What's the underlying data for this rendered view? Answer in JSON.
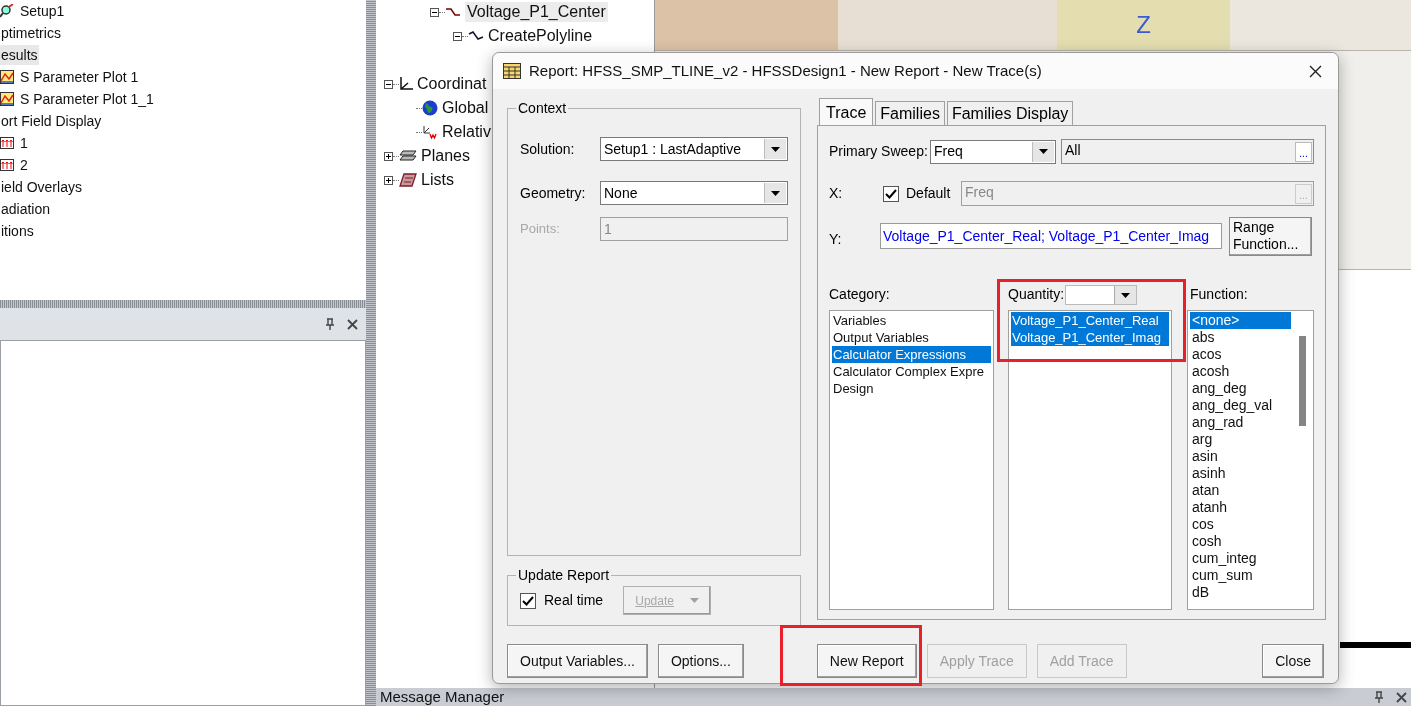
{
  "left_tree": {
    "items": [
      {
        "kind": "setup",
        "label": "Setup1",
        "selected": false
      },
      {
        "kind": "folder",
        "label": "ptimetrics",
        "selected": false
      },
      {
        "kind": "folder",
        "label": "esults",
        "selected": true,
        "children": [
          {
            "kind": "plot",
            "label": "S Parameter Plot 1",
            "selected": false
          },
          {
            "kind": "plot",
            "label": "S Parameter Plot 1_1",
            "selected": false
          }
        ]
      },
      {
        "kind": "folder",
        "label": "ort Field Display",
        "selected": false,
        "children": [
          {
            "kind": "port",
            "label": "1",
            "selected": false
          },
          {
            "kind": "port",
            "label": "2",
            "selected": false
          }
        ]
      },
      {
        "kind": "folder",
        "label": "ield Overlays",
        "selected": false
      },
      {
        "kind": "folder",
        "label": "adiation",
        "selected": false
      },
      {
        "kind": "folder",
        "label": "itions",
        "selected": false
      }
    ]
  },
  "middle_tree": {
    "top": [
      {
        "kind": "line",
        "label": "Voltage_P1_Center",
        "expanded": true,
        "selected": true,
        "children": [
          {
            "kind": "polyline",
            "label": "CreatePolyline",
            "expanded": true,
            "selected": false
          }
        ]
      }
    ],
    "items": [
      {
        "kind": "axes",
        "label": "Coordinat",
        "expanded": true,
        "selected": false,
        "children": [
          {
            "kind": "globe",
            "label": "Global",
            "selected": false
          },
          {
            "kind": "relative",
            "label": "Relativ",
            "selected": false
          }
        ]
      },
      {
        "kind": "planes",
        "label": "Planes",
        "expanded": false,
        "selected": false
      },
      {
        "kind": "lists",
        "label": "Lists",
        "expanded": false,
        "selected": false
      }
    ]
  },
  "viewport": {
    "axis_label": "Z"
  },
  "message_manager": {
    "title": "Message Manager"
  },
  "dialog": {
    "title": "Report: HFSS_SMP_TLINE_v2 - HFSSDesign1 - New Report - New Trace(s)",
    "context": {
      "group_label": "Context",
      "solution": {
        "label": "Solution:",
        "value": "Setup1 : LastAdaptive"
      },
      "geometry": {
        "label": "Geometry:",
        "value": "None"
      },
      "points": {
        "label": "Points:",
        "value": "1",
        "disabled": true
      }
    },
    "update_report": {
      "group_label": "Update Report",
      "real_time": {
        "label": "Real time",
        "checked": true
      },
      "update_button": {
        "label": "Update",
        "disabled": true
      }
    },
    "tabs": [
      {
        "label": "Trace",
        "selected": true
      },
      {
        "label": "Families",
        "selected": false
      },
      {
        "label": "Families Display",
        "selected": false
      }
    ],
    "primary_sweep": {
      "label": "Primary Sweep:",
      "value": "Freq",
      "range": "All",
      "browse": "..."
    },
    "x": {
      "label": "X:",
      "default": {
        "label": "Default",
        "checked": true
      },
      "value": "Freq",
      "disabled": true,
      "browse": "..."
    },
    "y": {
      "label": "Y:",
      "value": "Voltage_P1_Center_Real; Voltage_P1_Center_Imag",
      "button": "Range Function..."
    },
    "category": {
      "label": "Category:",
      "items": [
        {
          "label": "Variables",
          "selected": false
        },
        {
          "label": "Output Variables",
          "selected": false
        },
        {
          "label": "Calculator Expressions",
          "selected": true
        },
        {
          "label": "Calculator Complex Expre",
          "selected": false
        },
        {
          "label": "Design",
          "selected": false
        }
      ]
    },
    "quantity": {
      "label": "Quantity:",
      "items": [
        {
          "label": "Voltage_P1_Center_Real",
          "selected": true
        },
        {
          "label": "Voltage_P1_Center_Imag",
          "selected": true
        }
      ]
    },
    "function": {
      "label": "Function:",
      "items": [
        {
          "label": "<none>",
          "selected": true
        },
        {
          "label": "abs",
          "selected": false
        },
        {
          "label": "acos",
          "selected": false
        },
        {
          "label": "acosh",
          "selected": false
        },
        {
          "label": "ang_deg",
          "selected": false
        },
        {
          "label": "ang_deg_val",
          "selected": false
        },
        {
          "label": "ang_rad",
          "selected": false
        },
        {
          "label": "arg",
          "selected": false
        },
        {
          "label": "asin",
          "selected": false
        },
        {
          "label": "asinh",
          "selected": false
        },
        {
          "label": "atan",
          "selected": false
        },
        {
          "label": "atanh",
          "selected": false
        },
        {
          "label": "cos",
          "selected": false
        },
        {
          "label": "cosh",
          "selected": false
        },
        {
          "label": "cum_integ",
          "selected": false
        },
        {
          "label": "cum_sum",
          "selected": false
        },
        {
          "label": "dB",
          "selected": false
        }
      ]
    },
    "buttons": [
      {
        "label": "Output Variables...",
        "disabled": false
      },
      {
        "label": "Options...",
        "disabled": false
      },
      {
        "label": "New Report",
        "disabled": false
      },
      {
        "label": "Apply Trace",
        "disabled": true
      },
      {
        "label": "Add Trace",
        "disabled": true
      },
      {
        "label": "Close",
        "disabled": false
      }
    ]
  },
  "annotations": [
    {
      "kind": "box"
    },
    {
      "kind": "box"
    }
  ]
}
